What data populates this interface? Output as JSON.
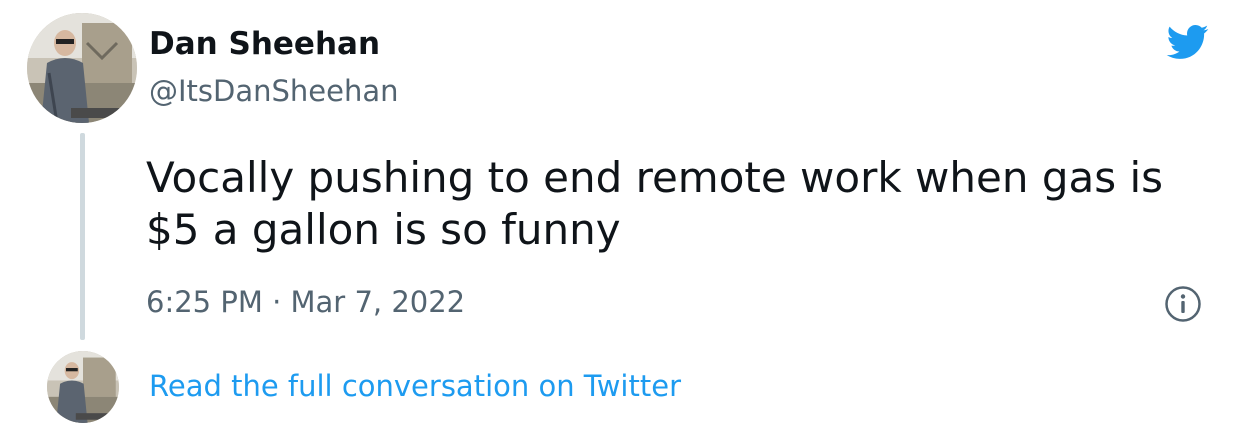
{
  "author": {
    "display_name": "Dan Sheehan",
    "handle": "@ItsDanSheehan",
    "avatar": "profile-photo"
  },
  "tweet": {
    "text": "Vocally pushing to end remote work when gas is $5 a gallon is so funny",
    "timestamp": "6:25 PM · Mar 7, 2022"
  },
  "footer": {
    "link_label": "Read the full conversation on Twitter"
  },
  "icons": {
    "brand": "twitter-bird-icon",
    "info": "info-icon"
  },
  "colors": {
    "brand_blue": "#1d9bf0",
    "text_primary": "#0f1419",
    "text_secondary": "#536471",
    "thread_line": "#cfd9de"
  }
}
